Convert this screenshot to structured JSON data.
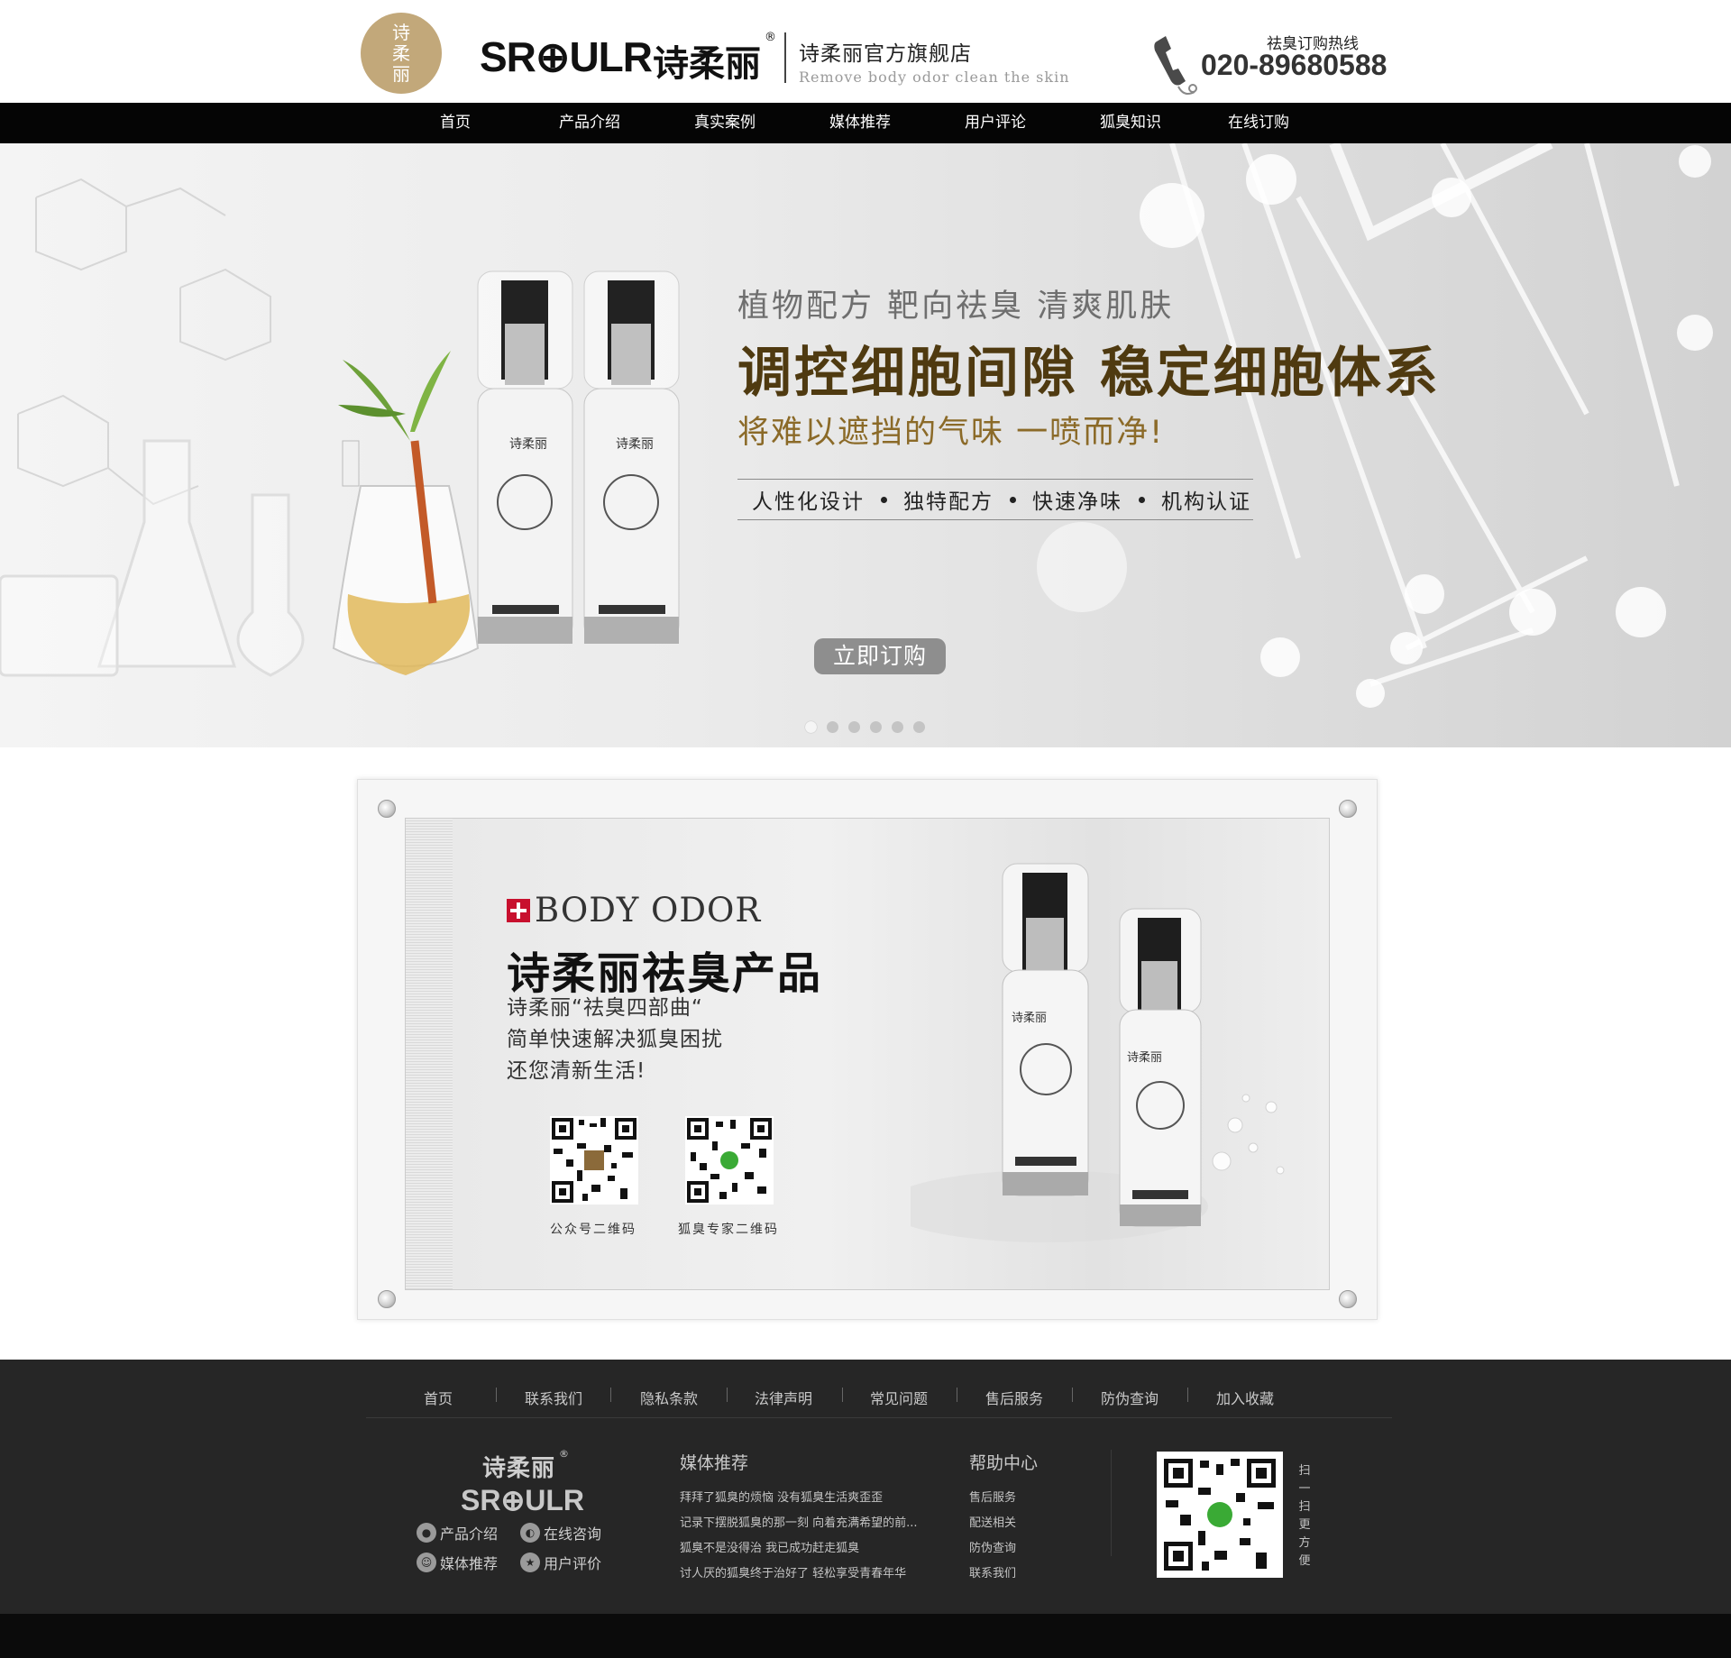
{
  "header": {
    "logo_chars": [
      "诗",
      "柔",
      "丽"
    ],
    "brand_en": "SR⊕ULR",
    "brand_cn": "诗柔丽",
    "registered": "®",
    "store_name": "诗柔丽官方旗舰店",
    "store_slogan": "Remove body odor clean the skin",
    "hotline_label": "祛臭订购热线",
    "hotline_number": "020-89680588"
  },
  "nav": {
    "items": [
      "首页",
      "产品介绍",
      "真实案例",
      "媒体推荐",
      "用户评论",
      "狐臭知识",
      "在线订购"
    ]
  },
  "banner": {
    "line1": "植物配方 靶向祛臭 清爽肌肤",
    "line2": "调控细胞间隙 稳定细胞体系",
    "line3": "将难以遮挡的气味 一喷而净!",
    "features": [
      "人性化设计",
      "独特配方",
      "快速净味",
      "机构认证"
    ],
    "order_button": "立即订购",
    "bottle_label": "诗柔丽",
    "dots_count": 6,
    "active_dot": 1
  },
  "product": {
    "badge_en": "BODY ODOR",
    "title": "诗柔丽祛臭产品",
    "lines": [
      "诗柔丽“祛臭四部曲“",
      "简单快速解决狐臭困扰",
      "还您清新生活!"
    ],
    "qr_labels": [
      "公众号二维码",
      "狐臭专家二维码"
    ],
    "bottle_label": "诗柔丽"
  },
  "footer": {
    "links": [
      "首页",
      "联系我们",
      "隐私条款",
      "法律声明",
      "常见问题",
      "售后服务",
      "防伪查询",
      "加入收藏"
    ],
    "brand_cn": "诗柔丽",
    "registered": "®",
    "brand_en": "SR⊕ULR",
    "quick_links": [
      "产品介绍",
      "在线咨询",
      "媒体推荐",
      "用户评价"
    ],
    "media_heading": "媒体推荐",
    "media_items": [
      "拜拜了狐臭的烦恼 没有狐臭生活爽歪歪",
      "记录下摆脱狐臭的那一刻 向着充满希望的前...",
      "狐臭不是没得治 我已成功赶走狐臭",
      "讨人厌的狐臭终于治好了 轻松享受青春年华"
    ],
    "help_heading": "帮助中心",
    "help_items": [
      "售后服务",
      "配送相关",
      "防伪查询",
      "联系我们"
    ],
    "scan_text": [
      "扫",
      "一",
      "扫",
      "更",
      "方",
      "便"
    ]
  },
  "colors": {
    "nav_bg": "#050505",
    "logo_gold": "#c2a87a",
    "banner_title": "#4f3a10",
    "banner_sub": "#8b6a28",
    "footer_bg": "#262626",
    "badge_red": "#c8102e"
  }
}
